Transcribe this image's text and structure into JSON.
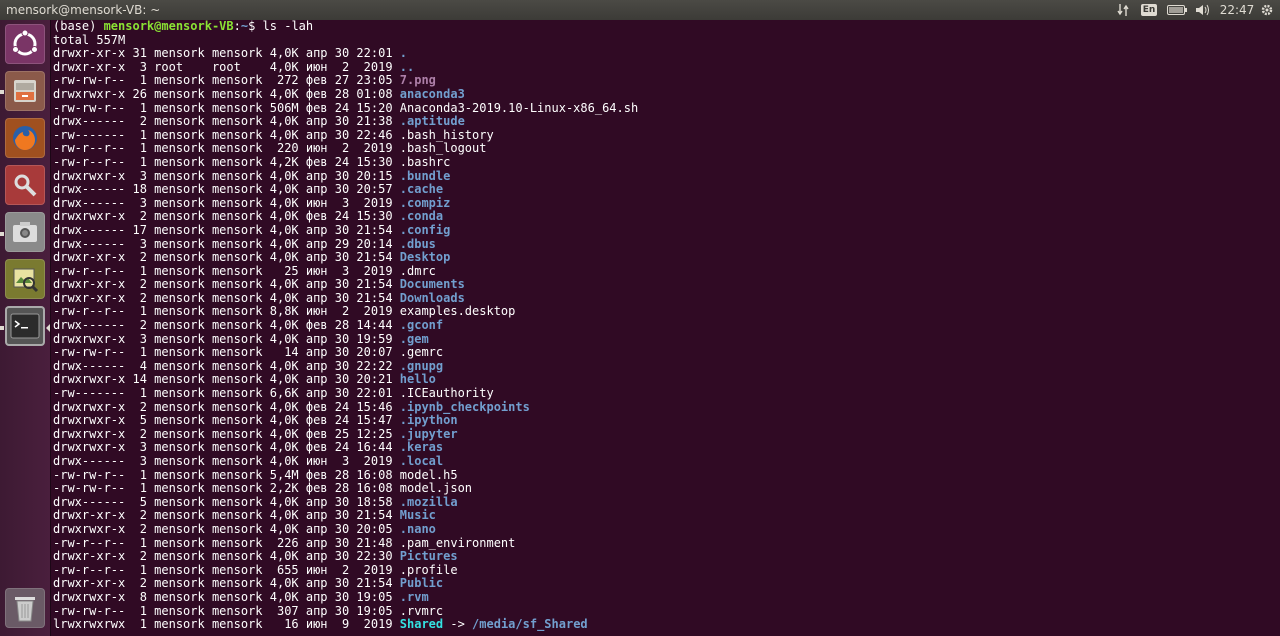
{
  "window": {
    "title": "mensork@mensork-VB: ~"
  },
  "panel": {
    "language": "En",
    "clock": "22:47"
  },
  "launcher": {
    "items": [
      "ubuntu-dash",
      "files",
      "firefox",
      "system-settings",
      "screenshot",
      "image-viewer",
      "terminal",
      "trash"
    ]
  },
  "terminal": {
    "prompt_prefix": "(base) ",
    "prompt_user": "mensork@mensork-VB",
    "prompt_sep": ":",
    "prompt_path": "~",
    "prompt_suffix": "$ ",
    "command": "ls -lah",
    "total": "total 557M",
    "listing": [
      {
        "meta": "drwxr-xr-x 31 mensork mensork 4,0K апр 30 22:01 ",
        "name": ".",
        "type": "dir"
      },
      {
        "meta": "drwxr-xr-x  3 root    root    4,0K июн  2  2019 ",
        "name": "..",
        "type": "dir"
      },
      {
        "meta": "-rw-rw-r--  1 mensork mensork  272 фев 27 23:05 ",
        "name": "7.png",
        "type": "img"
      },
      {
        "meta": "drwxrwxr-x 26 mensork mensork 4,0K фев 28 01:08 ",
        "name": "anaconda3",
        "type": "dir"
      },
      {
        "meta": "-rw-rw-r--  1 mensork mensork 506M фев 24 15:20 ",
        "name": "Anaconda3-2019.10-Linux-x86_64.sh",
        "type": "file"
      },
      {
        "meta": "drwx------  2 mensork mensork 4,0K апр 30 21:38 ",
        "name": ".aptitude",
        "type": "dir"
      },
      {
        "meta": "-rw-------  1 mensork mensork 4,0K апр 30 22:46 ",
        "name": ".bash_history",
        "type": "file"
      },
      {
        "meta": "-rw-r--r--  1 mensork mensork  220 июн  2  2019 ",
        "name": ".bash_logout",
        "type": "file"
      },
      {
        "meta": "-rw-r--r--  1 mensork mensork 4,2K фев 24 15:30 ",
        "name": ".bashrc",
        "type": "file"
      },
      {
        "meta": "drwxrwxr-x  3 mensork mensork 4,0K апр 30 20:15 ",
        "name": ".bundle",
        "type": "dir"
      },
      {
        "meta": "drwx------ 18 mensork mensork 4,0K апр 30 20:57 ",
        "name": ".cache",
        "type": "dir"
      },
      {
        "meta": "drwx------  3 mensork mensork 4,0K июн  3  2019 ",
        "name": ".compiz",
        "type": "dir"
      },
      {
        "meta": "drwxrwxr-x  2 mensork mensork 4,0K фев 24 15:30 ",
        "name": ".conda",
        "type": "dir"
      },
      {
        "meta": "drwx------ 17 mensork mensork 4,0K апр 30 21:54 ",
        "name": ".config",
        "type": "dir"
      },
      {
        "meta": "drwx------  3 mensork mensork 4,0K апр 29 20:14 ",
        "name": ".dbus",
        "type": "dir"
      },
      {
        "meta": "drwxr-xr-x  2 mensork mensork 4,0K апр 30 21:54 ",
        "name": "Desktop",
        "type": "dir"
      },
      {
        "meta": "-rw-r--r--  1 mensork mensork   25 июн  3  2019 ",
        "name": ".dmrc",
        "type": "file"
      },
      {
        "meta": "drwxr-xr-x  2 mensork mensork 4,0K апр 30 21:54 ",
        "name": "Documents",
        "type": "dir"
      },
      {
        "meta": "drwxr-xr-x  2 mensork mensork 4,0K апр 30 21:54 ",
        "name": "Downloads",
        "type": "dir"
      },
      {
        "meta": "-rw-r--r--  1 mensork mensork 8,8K июн  2  2019 ",
        "name": "examples.desktop",
        "type": "file"
      },
      {
        "meta": "drwx------  2 mensork mensork 4,0K фев 28 14:44 ",
        "name": ".gconf",
        "type": "dir"
      },
      {
        "meta": "drwxrwxr-x  3 mensork mensork 4,0K апр 30 19:59 ",
        "name": ".gem",
        "type": "dir"
      },
      {
        "meta": "-rw-rw-r--  1 mensork mensork   14 апр 30 20:07 ",
        "name": ".gemrc",
        "type": "file"
      },
      {
        "meta": "drwx------  4 mensork mensork 4,0K апр 30 22:22 ",
        "name": ".gnupg",
        "type": "dir"
      },
      {
        "meta": "drwxrwxr-x 14 mensork mensork 4,0K апр 30 20:21 ",
        "name": "hello",
        "type": "dir"
      },
      {
        "meta": "-rw-------  1 mensork mensork 6,6K апр 30 22:01 ",
        "name": ".ICEauthority",
        "type": "file"
      },
      {
        "meta": "drwxrwxr-x  2 mensork mensork 4,0K фев 24 15:46 ",
        "name": ".ipynb_checkpoints",
        "type": "dir"
      },
      {
        "meta": "drwxrwxr-x  5 mensork mensork 4,0K фев 24 15:47 ",
        "name": ".ipython",
        "type": "dir"
      },
      {
        "meta": "drwxrwxr-x  2 mensork mensork 4,0K фев 25 12:25 ",
        "name": ".jupyter",
        "type": "dir"
      },
      {
        "meta": "drwxrwxr-x  3 mensork mensork 4,0K фев 24 16:44 ",
        "name": ".keras",
        "type": "dir"
      },
      {
        "meta": "drwx------  3 mensork mensork 4,0K июн  3  2019 ",
        "name": ".local",
        "type": "dir"
      },
      {
        "meta": "-rw-rw-r--  1 mensork mensork 5,4M фев 28 16:08 ",
        "name": "model.h5",
        "type": "file"
      },
      {
        "meta": "-rw-rw-r--  1 mensork mensork 2,2K фев 28 16:08 ",
        "name": "model.json",
        "type": "file"
      },
      {
        "meta": "drwx------  5 mensork mensork 4,0K апр 30 18:58 ",
        "name": ".mozilla",
        "type": "dir"
      },
      {
        "meta": "drwxr-xr-x  2 mensork mensork 4,0K апр 30 21:54 ",
        "name": "Music",
        "type": "dir"
      },
      {
        "meta": "drwxrwxr-x  2 mensork mensork 4,0K апр 30 20:05 ",
        "name": ".nano",
        "type": "dir"
      },
      {
        "meta": "-rw-r--r--  1 mensork mensork  226 апр 30 21:48 ",
        "name": ".pam_environment",
        "type": "file"
      },
      {
        "meta": "drwxr-xr-x  2 mensork mensork 4,0K апр 30 22:30 ",
        "name": "Pictures",
        "type": "dir"
      },
      {
        "meta": "-rw-r--r--  1 mensork mensork  655 июн  2  2019 ",
        "name": ".profile",
        "type": "file"
      },
      {
        "meta": "drwxr-xr-x  2 mensork mensork 4,0K апр 30 21:54 ",
        "name": "Public",
        "type": "dir"
      },
      {
        "meta": "drwxrwxr-x  8 mensork mensork 4,0K апр 30 19:05 ",
        "name": ".rvm",
        "type": "dir"
      },
      {
        "meta": "-rw-rw-r--  1 mensork mensork  307 апр 30 19:05 ",
        "name": ".rvmrc",
        "type": "file"
      },
      {
        "meta": "lrwxrwxrwx  1 mensork mensork   16 июн  9  2019 ",
        "name": "Shared",
        "type": "lnk",
        "arrow": " -> ",
        "target": "/media/sf_Shared"
      }
    ]
  },
  "colors": {
    "terminal_bg": "#300a24",
    "dir": "#729fcf",
    "image": "#ad7fa8",
    "symlink": "#34e2e2",
    "prompt_user": "#8ae234"
  }
}
